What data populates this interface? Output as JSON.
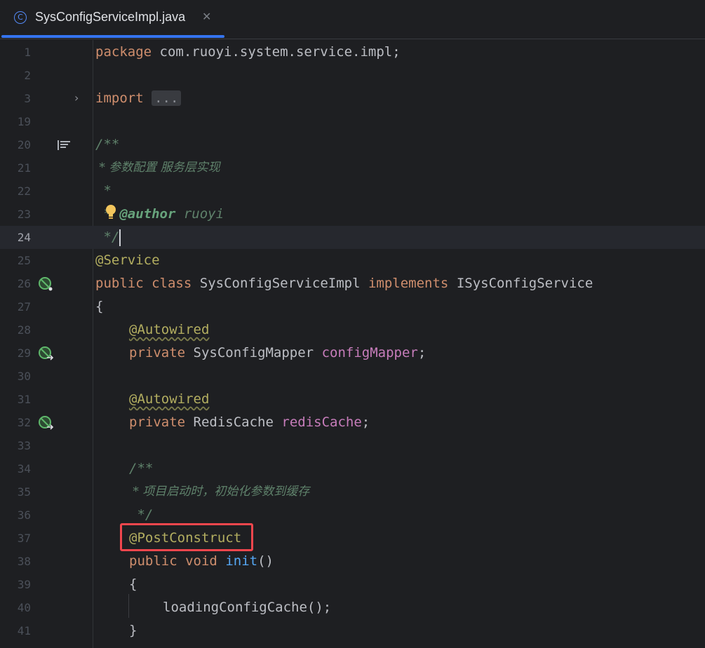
{
  "tab": {
    "icon_letter": "C",
    "title": "SysConfigServiceImpl.java",
    "close_glyph": "✕"
  },
  "gutter": {
    "line_numbers": [
      "1",
      "2",
      "3",
      "19",
      "20",
      "21",
      "22",
      "23",
      "24",
      "25",
      "26",
      "27",
      "28",
      "29",
      "30",
      "31",
      "32",
      "33",
      "34",
      "35",
      "36",
      "37",
      "38",
      "39",
      "40",
      "41"
    ]
  },
  "code": {
    "l1_kw": "package",
    "l1_rest": " com.ruoyi.system.service.impl;",
    "l3_kw": "import",
    "l3_fold": "...",
    "l20": "/**",
    "l21": " * 参数配置 服务层实现",
    "l22": " *",
    "l23_star": " * ",
    "l23_tag": "@author",
    "l23_rest": " ruoyi",
    "l24": " */",
    "l25": "@Service",
    "l26_kw1": "public",
    "l26_kw2": "class",
    "l26_name": "SysConfigServiceImpl",
    "l26_kw3": "implements",
    "l26_iface": "ISysConfigService",
    "l27": "{",
    "l28": "@Autowired",
    "l29_kw": "private",
    "l29_type": "SysConfigMapper",
    "l29_field": "configMapper",
    "l29_end": ";",
    "l31": "@Autowired",
    "l32_kw": "private",
    "l32_type": "RedisCache",
    "l32_field": "redisCache",
    "l32_end": ";",
    "l34": "/**",
    "l35": " * 项目启动时，初始化参数到缓存",
    "l36": " */",
    "l37": "@PostConstruct",
    "l38_kw1": "public",
    "l38_kw2": "void",
    "l38_fn": "init",
    "l38_end": "()",
    "l39": "{",
    "l40": "loadingConfigCache();",
    "l41": "}"
  },
  "colors": {
    "keyword": "#cf8e6d",
    "annotation": "#b3ae60",
    "field": "#c77dbb",
    "method": "#56a8f5",
    "comment": "#5f826b",
    "highlight_box": "#f0464d",
    "tab_accent": "#3574f0"
  },
  "icons": {
    "fold": "chevron-right-icon",
    "docs": "render-docs-icon",
    "bean": "spring-bean-icon",
    "intention": "lightbulb-icon"
  }
}
